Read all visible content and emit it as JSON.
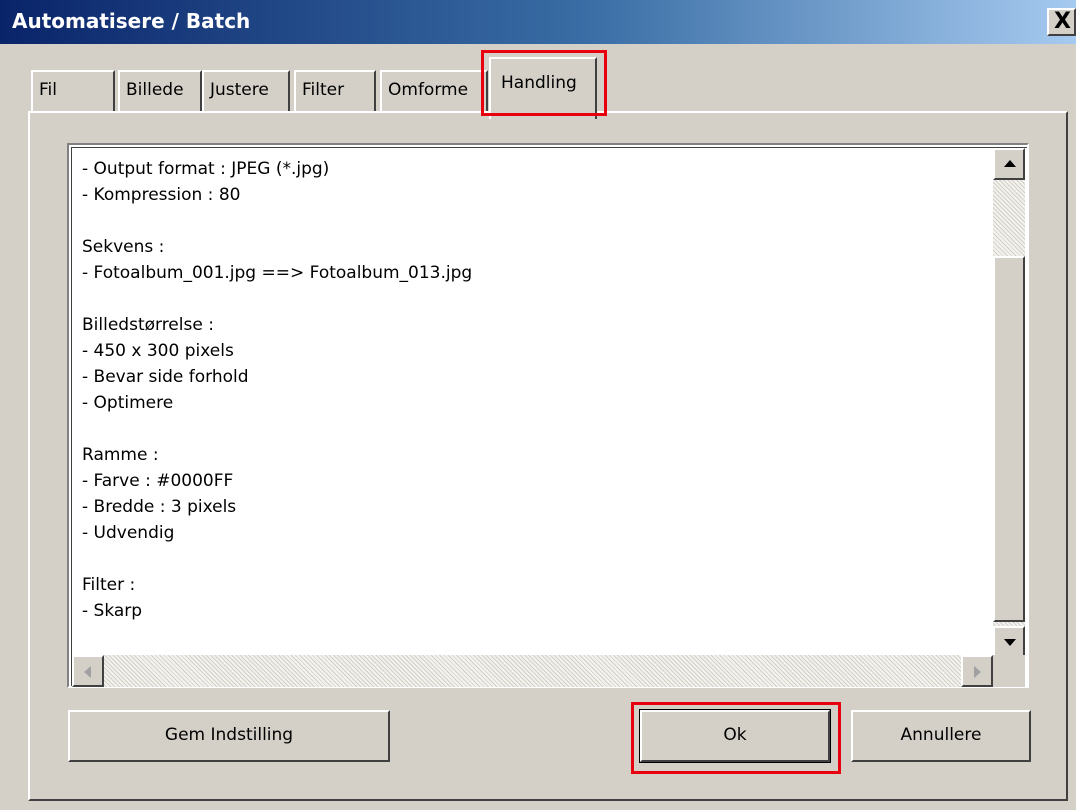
{
  "window": {
    "title": "Automatisere / Batch",
    "close_label": "X"
  },
  "tabs": [
    {
      "label": "Fil",
      "active": false
    },
    {
      "label": "Billede",
      "active": false
    },
    {
      "label": "Justere",
      "active": false
    },
    {
      "label": "Filter",
      "active": false
    },
    {
      "label": "Omforme",
      "active": false
    },
    {
      "label": "Handling",
      "active": true
    }
  ],
  "summary_lines": [
    "- Output format : JPEG (*.jpg)",
    "- Kompression : 80",
    "",
    "Sekvens :",
    "- Fotoalbum_001.jpg ==> Fotoalbum_013.jpg",
    "",
    "Billedstørrelse :",
    "- 450 x 300 pixels",
    "- Bevar side forhold",
    "- Optimere",
    "",
    "Ramme :",
    "- Farve : #0000FF",
    "- Bredde : 3 pixels",
    "- Udvendig",
    "",
    "Filter :",
    "- Skarp"
  ],
  "buttons": {
    "save_settings": "Gem Indstilling",
    "ok": "Ok",
    "cancel": "Annullere"
  },
  "colors": {
    "highlight": "#e8000f",
    "title_bar": "#0a246a",
    "dialog_bg": "#d4d0c8"
  }
}
